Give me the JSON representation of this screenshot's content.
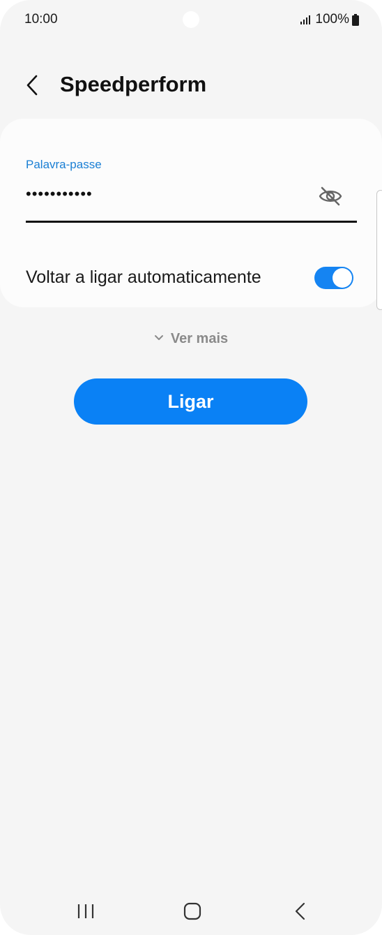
{
  "status_bar": {
    "time": "10:00",
    "battery": "100%",
    "icons": [
      "signal-icon",
      "battery-icon"
    ]
  },
  "header": {
    "title": "Speedperform",
    "back_icon": "back-arrow-icon"
  },
  "form": {
    "password_label": "Palavra-passe",
    "password_value": "•••••••••••",
    "visibility_icon": "eye-off-icon",
    "auto_reconnect_label": "Voltar a ligar automaticamente",
    "auto_reconnect_on": true
  },
  "more": {
    "label": "Ver mais",
    "icon": "chevron-down-icon"
  },
  "connect_button": {
    "label": "Ligar"
  },
  "nav_bar": {
    "icons": [
      "recent-apps-icon",
      "home-icon",
      "back-icon"
    ]
  },
  "colors": {
    "accent": "#0a81f5",
    "label_blue": "#1a7fd4",
    "background": "#f5f5f5",
    "card": "#fcfcfc"
  }
}
